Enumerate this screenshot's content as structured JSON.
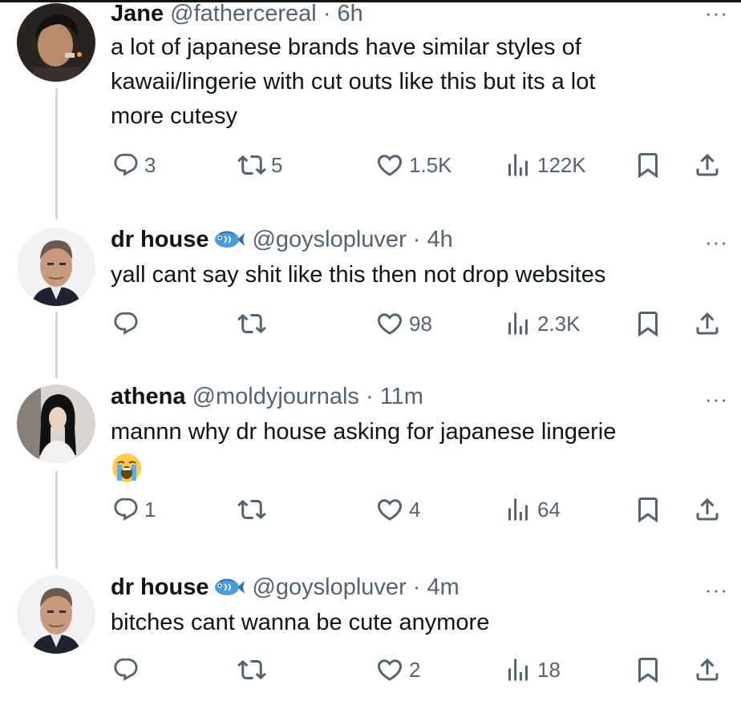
{
  "tweets": [
    {
      "name": "Jane",
      "handle": "@fathercereal",
      "time": "6h",
      "text_lines": [
        "a lot of japanese brands have similar styles of",
        "kawaii/lingerie with cut outs like this but its a lot",
        "more cutesy"
      ],
      "replies": "3",
      "reposts": "5",
      "likes": "1.5K",
      "views": "122K"
    },
    {
      "name": "dr house",
      "handle": "@goyslopluver",
      "time": "4h",
      "name_emoji": "fish-emoji",
      "text_lines": [
        "yall cant say shit like this then not drop websites"
      ],
      "replies": "",
      "reposts": "",
      "likes": "98",
      "views": "2.3K"
    },
    {
      "name": "athena",
      "handle": "@moldyjournals",
      "time": "11m",
      "text_lines": [
        "mannn why dr house asking for japanese lingerie"
      ],
      "text_emoji": "loudly-crying-face-emoji",
      "replies": "1",
      "reposts": "",
      "likes": "4",
      "views": "64"
    },
    {
      "name": "dr house",
      "handle": "@goyslopluver",
      "time": "4m",
      "name_emoji": "fish-emoji",
      "text_lines": [
        "bitches cant wanna be cute anymore"
      ],
      "replies": "",
      "reposts": "",
      "likes": "2",
      "views": "18"
    }
  ],
  "separator": " · ",
  "more_label": "···",
  "icons": [
    "reply-icon",
    "repost-icon",
    "like-icon",
    "views-icon",
    "bookmark-icon",
    "share-icon",
    "more-icon"
  ],
  "colors": {
    "text": "#0f1419",
    "secondary": "#536471",
    "thread_line": "#cfd9de"
  }
}
